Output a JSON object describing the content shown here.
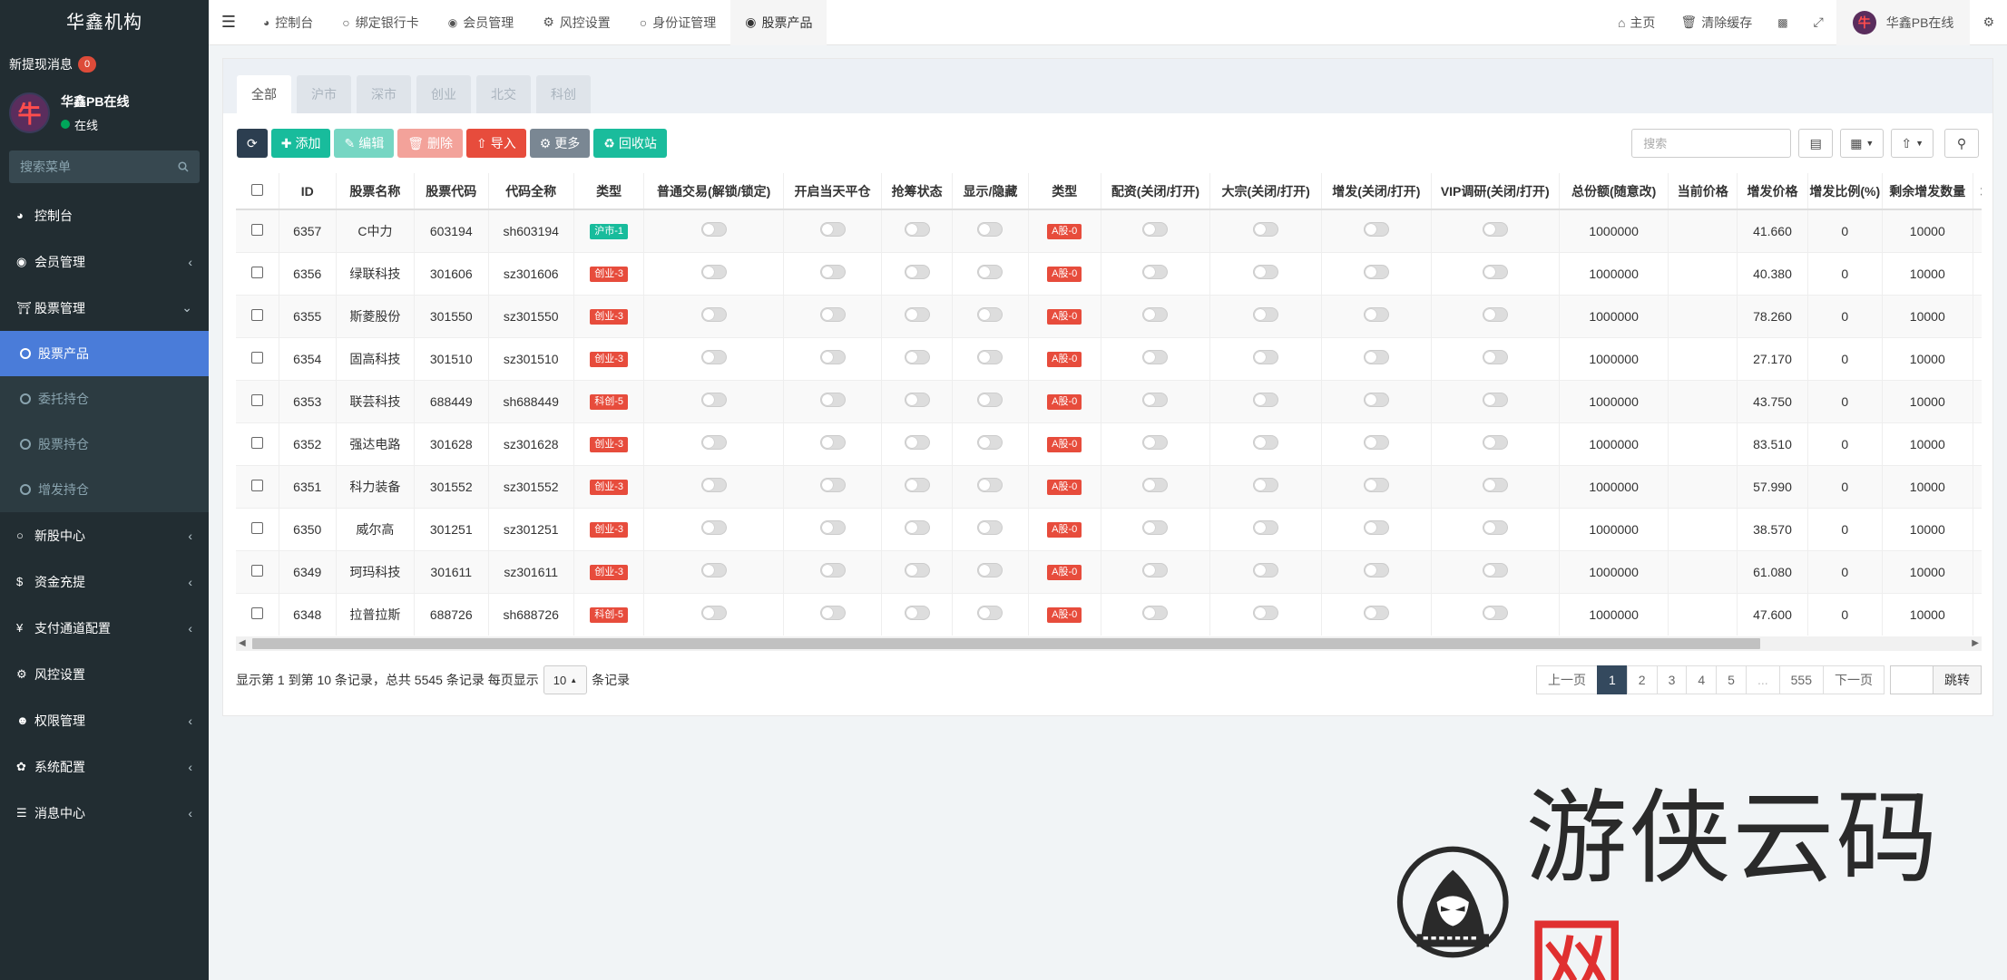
{
  "sidebar": {
    "brand": "华鑫机构",
    "notice_label": "新提现消息",
    "notice_count": "0",
    "user_name": "华鑫PB在线",
    "user_status": "在线",
    "search_placeholder": "搜索菜单",
    "menu": [
      {
        "label": "控制台",
        "icon": "dashboard-icon"
      },
      {
        "label": "会员管理",
        "icon": "user-icon"
      },
      {
        "label": "股票管理",
        "icon": "bank-icon"
      },
      {
        "label": "新股中心",
        "icon": "circle-icon"
      },
      {
        "label": "资金充提",
        "icon": "dollar-icon"
      },
      {
        "label": "支付通道配置",
        "icon": "yen-icon"
      },
      {
        "label": "风控设置",
        "icon": "gear-icon"
      },
      {
        "label": "权限管理",
        "icon": "group-icon"
      },
      {
        "label": "系统配置",
        "icon": "cogs-icon"
      },
      {
        "label": "消息中心",
        "icon": "list-icon"
      }
    ],
    "submenu": [
      {
        "label": "股票产品",
        "active": true
      },
      {
        "label": "委托持仓"
      },
      {
        "label": "股票持仓"
      },
      {
        "label": "增发持仓"
      }
    ]
  },
  "topbar": {
    "tabs": [
      {
        "label": "控制台",
        "icon": "dashboard-icon"
      },
      {
        "label": "绑定银行卡",
        "icon": "circle-icon"
      },
      {
        "label": "会员管理",
        "icon": "user-icon"
      },
      {
        "label": "风控设置",
        "icon": "gear-icon"
      },
      {
        "label": "身份证管理",
        "icon": "circle-icon"
      },
      {
        "label": "股票产品",
        "icon": "dot-circle-icon"
      }
    ],
    "home": "主页",
    "clear_cache": "清除缓存",
    "user_name": "华鑫PB在线"
  },
  "filter_tabs": [
    "全部",
    "沪市",
    "深市",
    "创业",
    "北交",
    "科创"
  ],
  "toolbar": {
    "add": "添加",
    "edit": "编辑",
    "delete": "删除",
    "import": "导入",
    "more": "更多",
    "recycle": "回收站",
    "search_placeholder": "搜索"
  },
  "table": {
    "columns": [
      "ID",
      "股票名称",
      "股票代码",
      "代码全称",
      "类型",
      "普通交易(解锁/锁定)",
      "开启当天平仓",
      "抢筹状态",
      "显示/隐藏",
      "类型",
      "配资(关闭/打开)",
      "大宗(关闭/打开)",
      "增发(关闭/打开)",
      "VIP调研(关闭/打开)",
      "总份额(随意改)",
      "当前价格",
      "增发价格",
      "增发比例(%)",
      "剩余增发数量",
      "增发"
    ],
    "rows": [
      {
        "id": "6357",
        "name": "C中力",
        "code": "603194",
        "full": "sh603194",
        "type": "沪市-1",
        "type_color": "green",
        "atype": "A股-0",
        "total": "1000000",
        "price": "",
        "zf_price": "41.660",
        "ratio": "0",
        "remain": "10000"
      },
      {
        "id": "6356",
        "name": "绿联科技",
        "code": "301606",
        "full": "sz301606",
        "type": "创业-3",
        "type_color": "red",
        "atype": "A股-0",
        "total": "1000000",
        "price": "",
        "zf_price": "40.380",
        "ratio": "0",
        "remain": "10000"
      },
      {
        "id": "6355",
        "name": "斯菱股份",
        "code": "301550",
        "full": "sz301550",
        "type": "创业-3",
        "type_color": "red",
        "atype": "A股-0",
        "total": "1000000",
        "price": "",
        "zf_price": "78.260",
        "ratio": "0",
        "remain": "10000"
      },
      {
        "id": "6354",
        "name": "固高科技",
        "code": "301510",
        "full": "sz301510",
        "type": "创业-3",
        "type_color": "red",
        "atype": "A股-0",
        "total": "1000000",
        "price": "",
        "zf_price": "27.170",
        "ratio": "0",
        "remain": "10000"
      },
      {
        "id": "6353",
        "name": "联芸科技",
        "code": "688449",
        "full": "sh688449",
        "type": "科创-5",
        "type_color": "red",
        "atype": "A股-0",
        "total": "1000000",
        "price": "",
        "zf_price": "43.750",
        "ratio": "0",
        "remain": "10000"
      },
      {
        "id": "6352",
        "name": "强达电路",
        "code": "301628",
        "full": "sz301628",
        "type": "创业-3",
        "type_color": "red",
        "atype": "A股-0",
        "total": "1000000",
        "price": "",
        "zf_price": "83.510",
        "ratio": "0",
        "remain": "10000"
      },
      {
        "id": "6351",
        "name": "科力装备",
        "code": "301552",
        "full": "sz301552",
        "type": "创业-3",
        "type_color": "red",
        "atype": "A股-0",
        "total": "1000000",
        "price": "",
        "zf_price": "57.990",
        "ratio": "0",
        "remain": "10000"
      },
      {
        "id": "6350",
        "name": "威尔高",
        "code": "301251",
        "full": "sz301251",
        "type": "创业-3",
        "type_color": "red",
        "atype": "A股-0",
        "total": "1000000",
        "price": "",
        "zf_price": "38.570",
        "ratio": "0",
        "remain": "10000"
      },
      {
        "id": "6349",
        "name": "珂玛科技",
        "code": "301611",
        "full": "sz301611",
        "type": "创业-3",
        "type_color": "red",
        "atype": "A股-0",
        "total": "1000000",
        "price": "",
        "zf_price": "61.080",
        "ratio": "0",
        "remain": "10000"
      },
      {
        "id": "6348",
        "name": "拉普拉斯",
        "code": "688726",
        "full": "sh688726",
        "type": "科创-5",
        "type_color": "red",
        "atype": "A股-0",
        "total": "1000000",
        "price": "",
        "zf_price": "47.600",
        "ratio": "0",
        "remain": "10000"
      }
    ]
  },
  "footer": {
    "summary": "显示第 1 到第 10 条记录，总共 5545 条记录 每页显示",
    "page_size": "10",
    "suffix": "条记录",
    "prev": "上一页",
    "pages": [
      "1",
      "2",
      "3",
      "4",
      "5",
      "...",
      "555"
    ],
    "next": "下一页",
    "go": "跳转"
  },
  "watermark": {
    "text_dark": "游侠云码",
    "text_red": "网"
  },
  "colors": {
    "sidebar": "#222d32",
    "active": "#4a7cd9",
    "green": "#18bc9c",
    "red": "#e74c3c",
    "dark": "#2c3e50"
  }
}
